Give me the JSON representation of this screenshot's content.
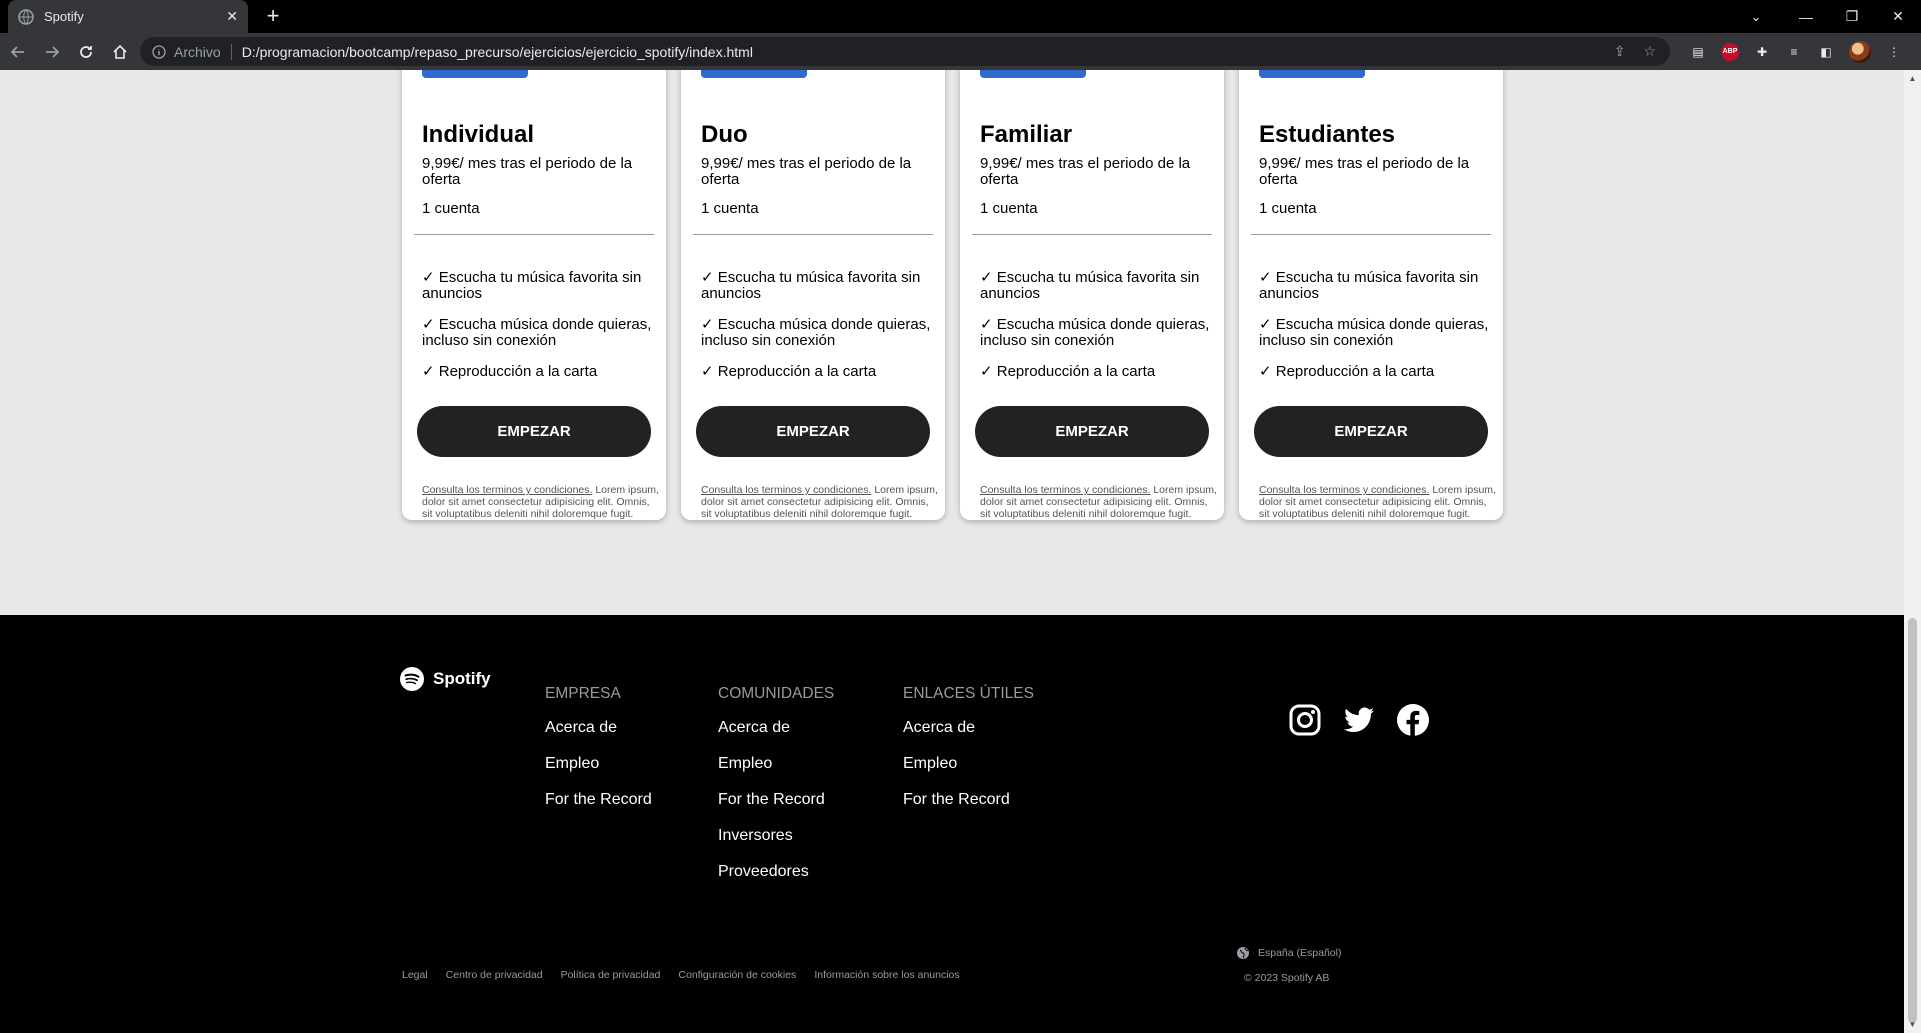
{
  "browser": {
    "tab_title": "Spotify",
    "new_tab_label": "+",
    "scheme_label": "Archivo",
    "url": "D:/programacion/bootcamp/repaso_precurso/ejercicios/ejercicio_spotify/index.html"
  },
  "plans": [
    {
      "name": "Individual",
      "price": "9,99€/ mes tras el periodo de la oferta",
      "accounts": "1 cuenta",
      "features": [
        "✓ Escucha tu música favorita sin anuncios",
        "✓ Escucha música donde quieras, incluso sin conexión",
        "✓ Reproducción a la carta"
      ],
      "cta": "EMPEZAR",
      "terms_link": "Consulta los terminos y condiciones.",
      "terms_text": " Lorem ipsum, dolor sit amet consectetur adipisicing elit. Omnis, sit voluptatibus deleniti nihil doloremque fugit."
    },
    {
      "name": "Duo",
      "price": "9,99€/ mes tras el periodo de la oferta",
      "accounts": "1 cuenta",
      "features": [
        "✓ Escucha tu música favorita sin anuncios",
        "✓ Escucha música donde quieras, incluso sin conexión",
        "✓ Reproducción a la carta"
      ],
      "cta": "EMPEZAR",
      "terms_link": "Consulta los terminos y condiciones.",
      "terms_text": " Lorem ipsum, dolor sit amet consectetur adipisicing elit. Omnis, sit voluptatibus deleniti nihil doloremque fugit."
    },
    {
      "name": "Familiar",
      "price": "9,99€/ mes tras el periodo de la oferta",
      "accounts": "1 cuenta",
      "features": [
        "✓ Escucha tu música favorita sin anuncios",
        "✓ Escucha música donde quieras, incluso sin conexión",
        "✓ Reproducción a la carta"
      ],
      "cta": "EMPEZAR",
      "terms_link": "Consulta los terminos y condiciones.",
      "terms_text": " Lorem ipsum, dolor sit amet consectetur adipisicing elit. Omnis, sit voluptatibus deleniti nihil doloremque fugit."
    },
    {
      "name": "Estudiantes",
      "price": "9,99€/ mes tras el periodo de la oferta",
      "accounts": "1 cuenta",
      "features": [
        "✓ Escucha tu música favorita sin anuncios",
        "✓ Escucha música donde quieras, incluso sin conexión",
        "✓ Reproducción a la carta"
      ],
      "cta": "EMPEZAR",
      "terms_link": "Consulta los terminos y condiciones.",
      "terms_text": " Lorem ipsum, dolor sit amet consectetur adipisicing elit. Omnis, sit voluptatibus deleniti nihil doloremque fugit."
    }
  ],
  "footer": {
    "logo_text": "Spotify",
    "columns": [
      {
        "title": "EMPRESA",
        "links": [
          "Acerca de",
          "Empleo",
          "For the Record"
        ]
      },
      {
        "title": "COMUNIDADES",
        "links": [
          "Acerca de",
          "Empleo",
          "For the Record",
          "Inversores",
          "Proveedores"
        ]
      },
      {
        "title": "ENLACES ÚTILES",
        "links": [
          "Acerca de",
          "Empleo",
          "For the Record"
        ]
      }
    ],
    "social": [
      "instagram-icon",
      "twitter-icon",
      "facebook-icon"
    ],
    "bottom_links": [
      "Legal",
      "Centro de privacidad",
      "Política de privacidad",
      "Configuración de cookies",
      "Información sobre los anuncios"
    ],
    "language": "España (Español)",
    "copyright": "© 2023 Spotify AB"
  },
  "colors": {
    "badge": "#2d6bcc",
    "button": "#222222",
    "footer_bg": "#000000",
    "page_bg": "#e8e8e8"
  }
}
